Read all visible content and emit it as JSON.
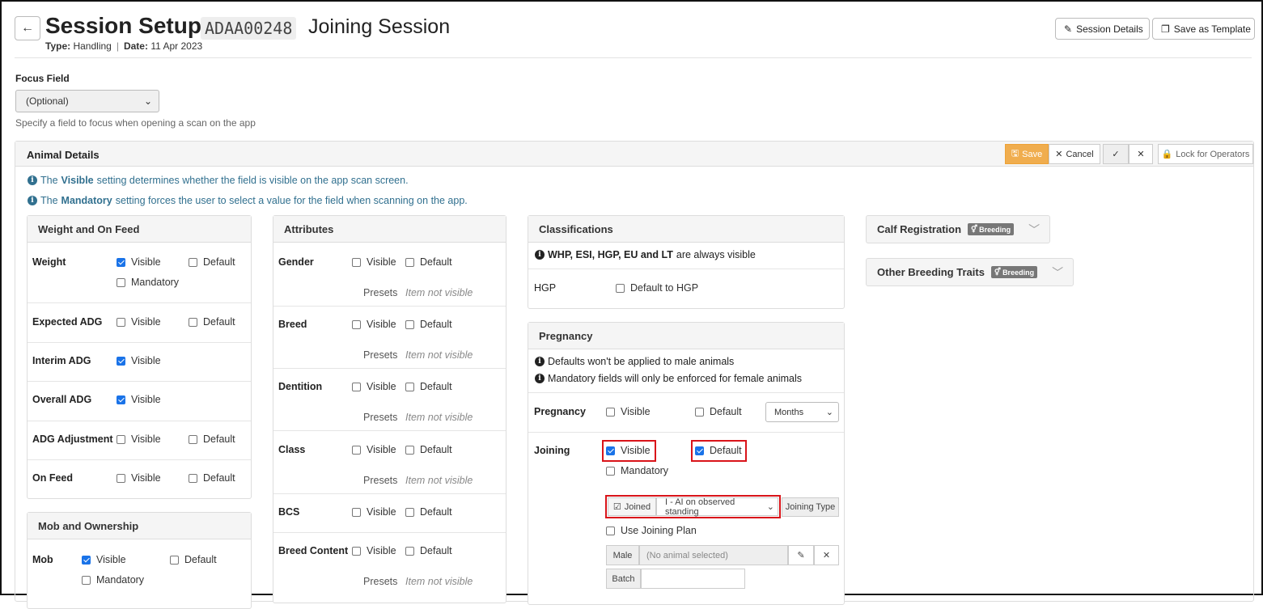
{
  "header": {
    "title": "Session Setup",
    "code": "ADAA00248",
    "subtitle": "Joining Session",
    "type_label": "Type:",
    "type_value": "Handling",
    "date_label": "Date:",
    "date_value": "11 Apr 2023",
    "session_details_label": "Session Details",
    "save_template_label": "Save as Template"
  },
  "focus": {
    "label": "Focus Field",
    "value": "(Optional)",
    "help": "Specify a field to focus when opening a scan on the app"
  },
  "animal": {
    "title": "Animal Details",
    "save": "Save",
    "cancel": "Cancel",
    "lock": "Lock for Operators",
    "info1_pre": "The",
    "info1_bold": "Visible",
    "info1_post": "setting determines whether the field is visible on the app scan screen.",
    "info2_pre": "The",
    "info2_bold": "Mandatory",
    "info2_post": "setting forces the user to select a value for the field when scanning on the app."
  },
  "labels": {
    "visible": "Visible",
    "default": "Default",
    "mandatory": "Mandatory",
    "presets": "Presets",
    "not_visible": "Item not visible"
  },
  "weight": {
    "title": "Weight and On Feed",
    "rows": [
      "Weight",
      "Expected ADG",
      "Interim ADG",
      "Overall ADG",
      "ADG Adjustment",
      "On Feed"
    ]
  },
  "mob": {
    "title": "Mob and Ownership",
    "rows": [
      "Mob"
    ]
  },
  "attributes": {
    "title": "Attributes",
    "rows": [
      "Gender",
      "Breed",
      "Dentition",
      "Class",
      "BCS",
      "Breed Content"
    ]
  },
  "classifications": {
    "title": "Classifications",
    "info_bold": "WHP, ESI, HGP, EU and LT",
    "info_post": "are always visible",
    "hgp_label": "HGP",
    "hgp_option": "Default to HGP"
  },
  "pregnancy": {
    "title": "Pregnancy",
    "info1": "Defaults won't be applied to male animals",
    "info2": "Mandatory fields will only be enforced for female animals",
    "pregnancy_label": "Pregnancy",
    "months": "Months",
    "joining_label": "Joining",
    "joined": "Joined",
    "joining_type_value": "I - AI on observed standing",
    "joining_type_label": "Joining Type",
    "use_plan": "Use Joining Plan",
    "male_label": "Male",
    "male_value": "(No animal selected)",
    "batch_label": "Batch"
  },
  "right": {
    "calf": "Calf Registration",
    "other": "Other Breeding Traits",
    "badge": "Breeding"
  }
}
